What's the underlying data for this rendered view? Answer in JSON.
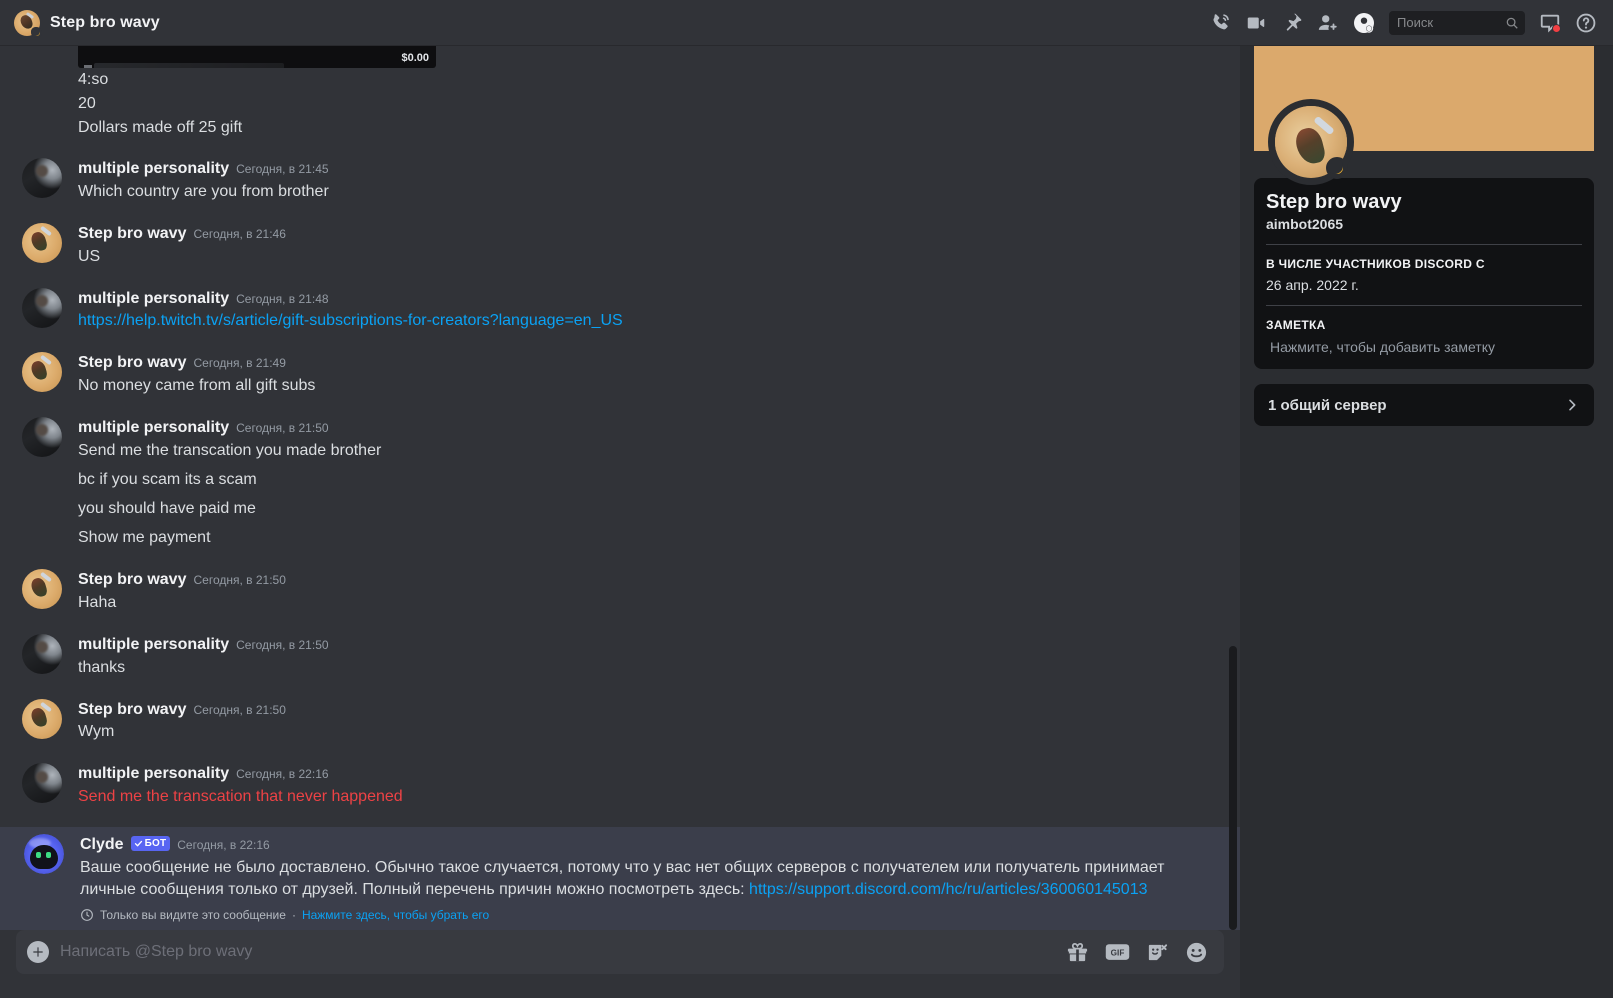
{
  "window": {
    "dm_title": "Step bro wavy"
  },
  "toolbar": {
    "call_label": "Начать голосовой звонок",
    "video_label": "Начать видеозвонок",
    "pin_label": "Закреплённые сообщения",
    "add_friend_label": "Добавить друзей в ЛС",
    "profile_label": "Показать профиль пользователя",
    "inbox_label": "Входящие",
    "help_label": "Справка"
  },
  "search": {
    "placeholder": "Поиск"
  },
  "embed_fragment": {
    "price": "$0.00"
  },
  "continued_lines": [
    "4:so",
    "20",
    "Dollars made off 25 gift"
  ],
  "messages": [
    {
      "author": "multiple personality",
      "avatar": "person",
      "timestamp": "Сегодня, в 21:45",
      "lines": [
        "Which country are you from brother"
      ]
    },
    {
      "author": "Step bro wavy",
      "avatar": "wavy",
      "timestamp": "Сегодня, в 21:46",
      "lines": [
        "US"
      ]
    },
    {
      "author": "multiple personality",
      "avatar": "person",
      "timestamp": "Сегодня, в 21:48",
      "lines": [
        "https://help.twitch.tv/s/article/gift-subscriptions-for-creators?language=en_US"
      ],
      "link": true
    },
    {
      "author": "Step bro wavy",
      "avatar": "wavy",
      "timestamp": "Сегодня, в 21:49",
      "lines": [
        "No money came from all gift subs"
      ]
    },
    {
      "author": "multiple personality",
      "avatar": "person",
      "timestamp": "Сегодня, в 21:50",
      "lines": [
        "Send me the transcation you made brother",
        "bc if you scam its a scam",
        "you should have paid me",
        "Show me payment"
      ]
    },
    {
      "author": "Step bro wavy",
      "avatar": "wavy",
      "timestamp": "Сегодня, в 21:50",
      "lines": [
        "Haha"
      ]
    },
    {
      "author": "multiple personality",
      "avatar": "person",
      "timestamp": "Сегодня, в 21:50",
      "lines": [
        "thanks"
      ]
    },
    {
      "author": "Step bro wavy",
      "avatar": "wavy",
      "timestamp": "Сегодня, в 21:50",
      "lines": [
        "Wym"
      ]
    },
    {
      "author": "multiple personality",
      "avatar": "person",
      "timestamp": "Сегодня, в 22:16",
      "lines": [
        "Send me the transcation that never happened"
      ],
      "failed": true
    }
  ],
  "clyde": {
    "author": "Clyde",
    "bot_badge": "БОТ",
    "timestamp": "Сегодня, в 22:16",
    "text_before_link": "Ваше сообщение не было доставлено. Обычно такое случается, потому что у вас нет общих серверов с получателем или получатель принимает личные сообщения только от друзей. Полный перечень причин можно посмотреть здесь: ",
    "link": "https://support.discord.com/hc/ru/articles/360060145013",
    "ephemeral_note": "Только вы видите это сообщение",
    "ephemeral_sep": "·",
    "ephemeral_action": "Нажмите здесь, чтобы убрать его"
  },
  "composer": {
    "placeholder": "Написать @Step bro wavy",
    "gift_label": "Подарить Nitro",
    "gif_label": "GIF",
    "sticker_label": "Стикеры",
    "emoji_label": "Эмодзи"
  },
  "profile": {
    "name": "Step bro wavy",
    "username": "aimbot2065",
    "member_since_label": "В числе участников Discord с",
    "member_since_value": "26 апр. 2022 г.",
    "note_label": "Заметка",
    "note_placeholder": "Нажмите, чтобы добавить заметку",
    "mutual_servers": "1 общий сервер"
  },
  "colors": {
    "accent": "#5865f2",
    "link": "#0aa2f4",
    "error": "#ed4245",
    "banner": "#dba96c",
    "idle": "#f0b232",
    "chat_bg": "#313338",
    "panel_bg": "#2b2d31",
    "card_bg": "#111214"
  }
}
